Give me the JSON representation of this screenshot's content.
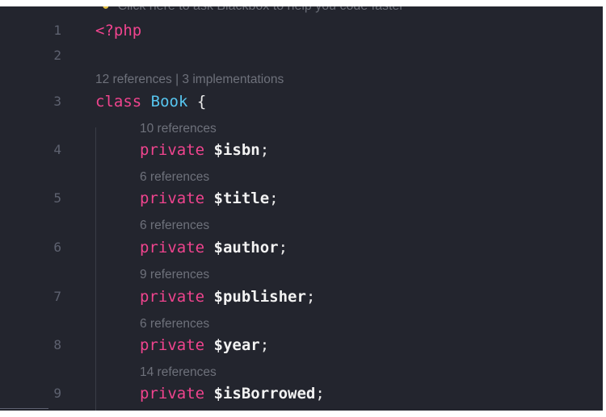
{
  "editor": {
    "hint": {
      "text": "Click here to ask Blackbox to help you code faster",
      "icon": "lightbulb-icon"
    },
    "lines": [
      {
        "number": "1",
        "token": "<?php"
      },
      {
        "number": "2",
        "token": ""
      },
      {
        "number": "3",
        "lens": "12 references | 3 implementations",
        "keyword": "class",
        "name": "Book",
        "brace": "{"
      },
      {
        "number": "4",
        "lens": "10 references",
        "keyword": "private",
        "variable": "$isbn",
        "punct": ";"
      },
      {
        "number": "5",
        "lens": "6 references",
        "keyword": "private",
        "variable": "$title",
        "punct": ";"
      },
      {
        "number": "6",
        "lens": "6 references",
        "keyword": "private",
        "variable": "$author",
        "punct": ";"
      },
      {
        "number": "7",
        "lens": "9 references",
        "keyword": "private",
        "variable": "$publisher",
        "punct": ";"
      },
      {
        "number": "8",
        "lens": "6 references",
        "keyword": "private",
        "variable": "$year",
        "punct": ";"
      },
      {
        "number": "9",
        "lens": "14 references",
        "keyword": "private",
        "variable": "$isBorrowed",
        "punct": ";"
      }
    ],
    "colors": {
      "background": "#23252e",
      "keyword": "#f0448e",
      "classname": "#57c6f0",
      "line_number": "#5e6270",
      "codelens": "#6e717b"
    }
  }
}
